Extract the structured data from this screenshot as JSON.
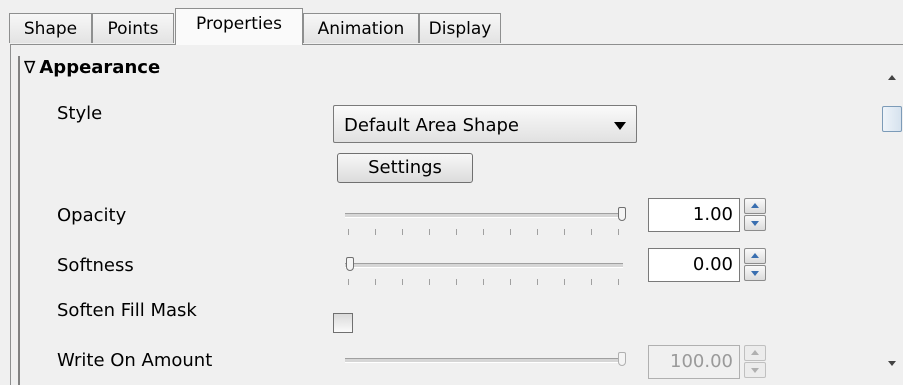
{
  "tabs": [
    {
      "label": "Shape"
    },
    {
      "label": "Points"
    },
    {
      "label": "Properties"
    },
    {
      "label": "Animation"
    },
    {
      "label": "Display"
    }
  ],
  "active_tab": "Properties",
  "section": {
    "toggle": "∇",
    "title": "Appearance"
  },
  "style": {
    "label": "Style",
    "value": "Default Area Shape",
    "settings_label": "Settings"
  },
  "opacity": {
    "label": "Opacity",
    "value": "1.00",
    "level": 1.0
  },
  "softness": {
    "label": "Softness",
    "value": "0.00",
    "level": 0.0
  },
  "soften_fill_mask": {
    "label": "Soften Fill Mask",
    "checked": false
  },
  "write_on": {
    "label": "Write On Amount",
    "value": "100.00",
    "level": 1.0,
    "disabled": true
  }
}
